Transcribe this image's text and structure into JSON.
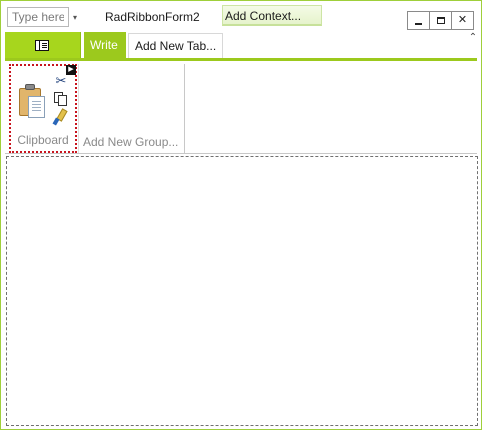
{
  "window": {
    "title": "RadRibbonForm2",
    "border_color": "#9fcf3a",
    "accent_color": "#9cc91d"
  },
  "quick_access": {
    "input_placeholder": "Type here",
    "dropdown_icon": "down-triangle-icon"
  },
  "context_button": {
    "label": "Add Context..."
  },
  "window_controls": {
    "minimize_icon": "minimize-icon",
    "maximize_icon": "maximize-icon",
    "close_icon": "close-icon",
    "close_glyph": "✕"
  },
  "tabs": {
    "app_button_icon": "application-menu-icon",
    "items": [
      {
        "label": "Write",
        "selected": true
      },
      {
        "label": "Add New Tab..."
      }
    ],
    "collapse_icon": "chevron-up-icon",
    "collapse_glyph": "⌃"
  },
  "ribbon": {
    "groups": [
      {
        "label": "Clipboard",
        "buttons": [
          "paste-icon",
          "cut-icon",
          "copy-icon",
          "format-painter-icon"
        ],
        "launcher_glyph": "▶"
      },
      {
        "label": "Add New Group..."
      }
    ]
  },
  "glyphs": {
    "qat_dropdown": "▾",
    "cut": "✂"
  }
}
